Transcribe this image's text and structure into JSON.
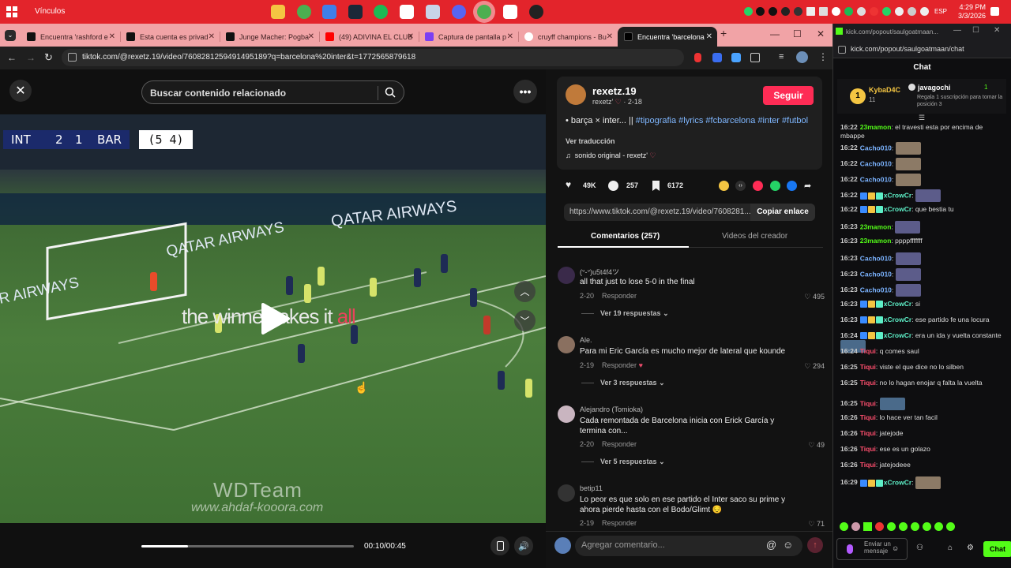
{
  "taskbar": {
    "vinculos": "Vínculos",
    "time": "4:29 PM",
    "date": "3/3/2026",
    "lang": "ESP"
  },
  "tabs": [
    {
      "label": "Encuentra 'rashford e"
    },
    {
      "label": "Esta cuenta es privad"
    },
    {
      "label": "Junge Macher: Pogba"
    },
    {
      "label": "(49) ADIVINA EL CLUB"
    },
    {
      "label": "Captura de pantalla p"
    },
    {
      "label": "cruyff champions - Bu"
    },
    {
      "label": "Encuentra 'barcelona"
    }
  ],
  "browser": {
    "url": "tiktok.com/@rexetz.19/video/7608281259491495189?q=barcelona%20inter&t=1772565879618"
  },
  "video": {
    "search_placeholder": "Buscar contenido relacionado",
    "score_home": "INT",
    "score_home_goals": "2",
    "score_away_goals": "1",
    "score_away": "BAR",
    "aggregate": "(5 4)",
    "overlay_main": "the winner takes it ",
    "overlay_accent": "all",
    "watermark1": "WDTeam",
    "watermark2": "www.ahdaf-kooora.com",
    "time": "00:10/00:45",
    "progress": 0.22
  },
  "post": {
    "username": "rexetz.19",
    "handle": "rexetz'",
    "date": "2-18",
    "follow": "Seguir",
    "caption_plain": "• barça × inter... || ",
    "caption_tags": "#tipografia #lyrics #fcbarcelona #inter #futbol",
    "translate": "Ver traducción",
    "sound": "sonido original - rexetz'",
    "likes": "49K",
    "comments": "257",
    "saves": "6172",
    "link": "https://www.tiktok.com/@rexetz.19/video/7608281...",
    "copy_link": "Copiar enlace",
    "tab_comments": "Comentarios (257)",
    "tab_creator": "Videos del creador",
    "comment_placeholder": "Agregar comentario..."
  },
  "comments": [
    {
      "user": "(ᐡ-ᐡ)u5t4f4ツ",
      "text": "all that just to lose 5-0 in the final",
      "date": "2-20",
      "reply": "Responder",
      "likes": "495",
      "more": "Ver 19 respuestas"
    },
    {
      "user": "Ale.",
      "text": "Para mi Eric García es mucho mejor de lateral que kounde",
      "date": "2-19",
      "reply": "Responder",
      "likes": "294",
      "more": "Ver 3 respuestas"
    },
    {
      "user": "Alejandro (Tomioka)",
      "text": "Cada remontada de Barcelona inicia con Erick García y termina con...",
      "date": "2-20",
      "reply": "Responder",
      "likes": "49",
      "more": "Ver 5 respuestas"
    },
    {
      "user": "betip11",
      "text": "Lo peor es que solo en ese partido el Inter saco su prime y ahora pierde hasta con el Bodo/Glimt 😔",
      "date": "2-19",
      "reply": "Responder",
      "likes": "71",
      "more": ""
    }
  ],
  "kick": {
    "titlebar": "kick.com/popout/saulgoatmaan...",
    "url": "kick.com/popout/saulgoatmaan/chat",
    "title": "Chat",
    "pinned_rank": "1",
    "pinned_user": "KybaD4C",
    "pinned_count": "11",
    "gift_user": "javagochi",
    "gift_count": "1",
    "gift_text": "Regala 1 suscripción para tomar la posición 3",
    "input": "Enviar un mensaje",
    "chat_button": "Chat"
  },
  "chat": [
    {
      "time": "16:22",
      "user": "23mamon",
      "color": "#53fc18",
      "text": "el travesti esta por encima de mbappe",
      "emote": ""
    },
    {
      "time": "16:22",
      "user": "Cacho010",
      "color": "#7bb3ff",
      "text": "",
      "emote": "brown"
    },
    {
      "time": "16:22",
      "user": "Cacho010",
      "color": "#7bb3ff",
      "text": "",
      "emote": "brown"
    },
    {
      "time": "16:22",
      "user": "Cacho010",
      "color": "#7bb3ff",
      "text": "",
      "emote": "brown"
    },
    {
      "time": "16:22",
      "user": "xCrowCr",
      "color": "#5ef0c8",
      "text": "",
      "emote": "purple",
      "badges": true
    },
    {
      "time": "16:22",
      "user": "xCrowCr",
      "color": "#5ef0c8",
      "text": "que bestia tu",
      "emote": "",
      "badges": true
    },
    {
      "time": "16:23",
      "user": "23mamon",
      "color": "#53fc18",
      "text": "",
      "emote": "purple"
    },
    {
      "time": "16:23",
      "user": "23mamon",
      "color": "#53fc18",
      "text": "ppppfffffff",
      "emote": ""
    },
    {
      "time": "16:23",
      "user": "Cacho010",
      "color": "#7bb3ff",
      "text": "",
      "emote": "purple"
    },
    {
      "time": "16:23",
      "user": "Cacho010",
      "color": "#7bb3ff",
      "text": "",
      "emote": "purple"
    },
    {
      "time": "16:23",
      "user": "Cacho010",
      "color": "#7bb3ff",
      "text": "",
      "emote": "purple"
    },
    {
      "time": "16:23",
      "user": "xCrowCr",
      "color": "#5ef0c8",
      "text": "si",
      "emote": "",
      "badges": true
    },
    {
      "time": "16:23",
      "user": "xCrowCr",
      "color": "#5ef0c8",
      "text": "ese partido fe una locura",
      "emote": "",
      "badges": true
    },
    {
      "time": "16:24",
      "user": "xCrowCr",
      "color": "#5ef0c8",
      "text": "era un ida y vuelta constante",
      "emote": "blue",
      "badges": true
    },
    {
      "time": "16:24",
      "user": "Tiqui",
      "color": "#ff4f6e",
      "text": "q comes saul",
      "emote": ""
    },
    {
      "time": "16:25",
      "user": "Tiqui",
      "color": "#ff4f6e",
      "text": "viste el que dice no lo silben",
      "emote": ""
    },
    {
      "time": "16:25",
      "user": "Tiqui",
      "color": "#ff4f6e",
      "text": "no lo hagan enojar q falta la vuelta",
      "emote": ""
    },
    {
      "time": "16:25",
      "user": "Tiqui",
      "color": "#ff4f6e",
      "text": "",
      "emote": "blue"
    },
    {
      "time": "16:26",
      "user": "Tiqui",
      "color": "#ff4f6e",
      "text": "lo hace ver tan facil",
      "emote": ""
    },
    {
      "time": "16:26",
      "user": "Tiqui",
      "color": "#ff4f6e",
      "text": "jatejode",
      "emote": ""
    },
    {
      "time": "16:26",
      "user": "Tiqui",
      "color": "#ff4f6e",
      "text": "ese es un golazo",
      "emote": ""
    },
    {
      "time": "16:26",
      "user": "Tiqui",
      "color": "#ff4f6e",
      "text": "jatejodeee",
      "emote": ""
    },
    {
      "time": "16:29",
      "user": "xCrowCr",
      "color": "#5ef0c8",
      "text": "",
      "emote": "brown",
      "badges": true
    }
  ]
}
